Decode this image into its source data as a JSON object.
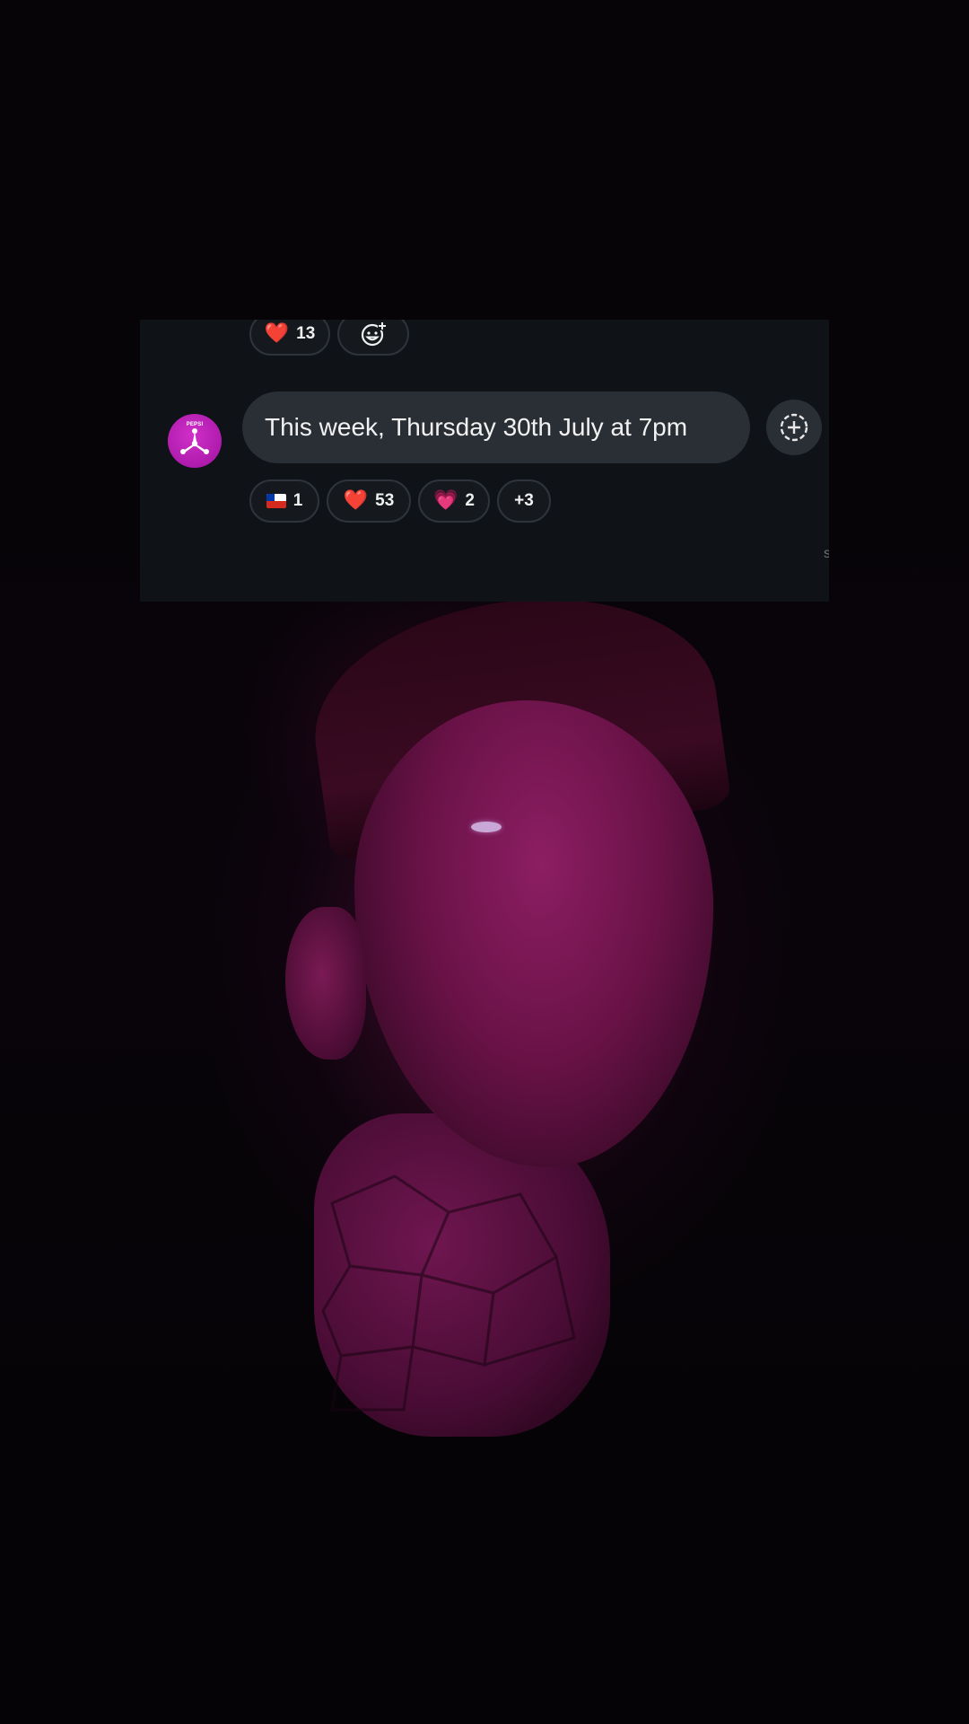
{
  "top_reactions": [
    {
      "emoji": "❤️",
      "count": "13"
    }
  ],
  "message": {
    "text": "This week, Thursday 30th July at 7pm",
    "sender_avatar_label": "PEPSI"
  },
  "reactions": [
    {
      "emoji": "chile-flag",
      "count": "1"
    },
    {
      "emoji": "❤️",
      "count": "53"
    },
    {
      "emoji": "💗",
      "count": "2"
    },
    {
      "label": "+3"
    }
  ],
  "edge_char": "s",
  "colors": {
    "card_bg": "#0f1216",
    "bubble_bg": "#2a2e35",
    "chip_border": "#2f343c",
    "avatar_accent": "#c21fbe",
    "photo_tint": "#7a1452"
  },
  "icons": {
    "add_reaction_top": "add-emoji-icon",
    "add_reaction_bubble": "add-reaction-icon"
  }
}
